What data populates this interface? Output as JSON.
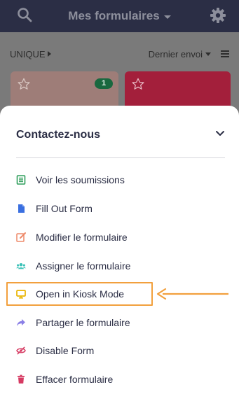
{
  "header": {
    "title": "Mes formulaires"
  },
  "subbar": {
    "filter_label": "UNIQUE",
    "sort_label": "Dernier envoi"
  },
  "cards": {
    "first_badge": "1"
  },
  "sheet": {
    "title": "Contactez-nous",
    "items": [
      {
        "label": "Voir les soumissions",
        "icon": "submissions-icon",
        "color": "#2f9e5b"
      },
      {
        "label": "Fill Out Form",
        "icon": "form-document-icon",
        "color": "#3a6fe0"
      },
      {
        "label": "Modifier le formulaire",
        "icon": "edit-icon",
        "color": "#ee8a6a"
      },
      {
        "label": "Assigner le formulaire",
        "icon": "assign-users-icon",
        "color": "#3cc2b8"
      },
      {
        "label": "Open in Kiosk Mode",
        "icon": "kiosk-monitor-icon",
        "color": "#e9b400"
      },
      {
        "label": "Partager le formulaire",
        "icon": "share-arrow-icon",
        "color": "#8a7fe6"
      },
      {
        "label": "Disable Form",
        "icon": "eye-slash-icon",
        "color": "#d63a62"
      },
      {
        "label": "Effacer formulaire",
        "icon": "trash-icon",
        "color": "#d63a62"
      }
    ]
  },
  "annotation": {
    "highlight_color": "#f2a03d",
    "highlighted_item": "Open in Kiosk Mode"
  },
  "colors": {
    "header_bg": "#2b2e45",
    "card_one": "#9e7d78",
    "card_two": "#a31f3b"
  }
}
